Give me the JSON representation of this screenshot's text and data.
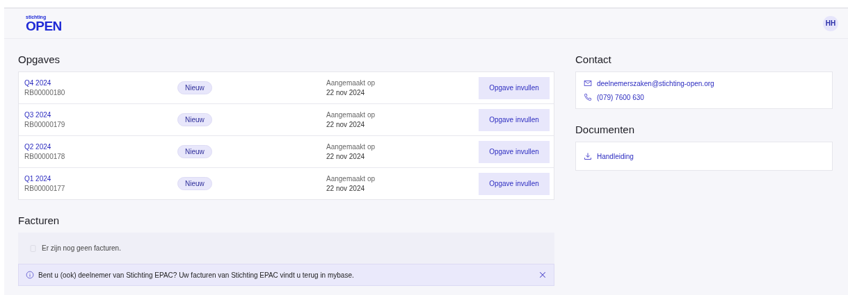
{
  "header": {
    "logo": {
      "small": "stichting",
      "main": "OPEN"
    },
    "avatar": "HH"
  },
  "opgaves": {
    "title": "Opgaves",
    "items": [
      {
        "period": "Q4 2024",
        "reference": "RB00000180",
        "status": "Nieuw",
        "created_label": "Aangemaakt op",
        "created_date": "22 nov 2024",
        "action": "Opgave invullen"
      },
      {
        "period": "Q3 2024",
        "reference": "RB00000179",
        "status": "Nieuw",
        "created_label": "Aangemaakt op",
        "created_date": "22 nov 2024",
        "action": "Opgave invullen"
      },
      {
        "period": "Q2 2024",
        "reference": "RB00000178",
        "status": "Nieuw",
        "created_label": "Aangemaakt op",
        "created_date": "22 nov 2024",
        "action": "Opgave invullen"
      },
      {
        "period": "Q1 2024",
        "reference": "RB00000177",
        "status": "Nieuw",
        "created_label": "Aangemaakt op",
        "created_date": "22 nov 2024",
        "action": "Opgave invullen"
      }
    ]
  },
  "facturen": {
    "title": "Facturen",
    "empty_text": "Er zijn nog geen facturen.",
    "notice": "Bent u (ook) deelnemer van Stichting EPAC? Uw facturen van Stichting EPAC vindt u terug in mybase."
  },
  "contact": {
    "title": "Contact",
    "items": [
      {
        "kind": "email",
        "text": "deelnemerszaken@stichting-open.org"
      },
      {
        "kind": "phone",
        "text": "(079) 7600 630"
      }
    ]
  },
  "documenten": {
    "title": "Documenten",
    "items": [
      {
        "kind": "download",
        "text": "Handleiding"
      }
    ]
  }
}
